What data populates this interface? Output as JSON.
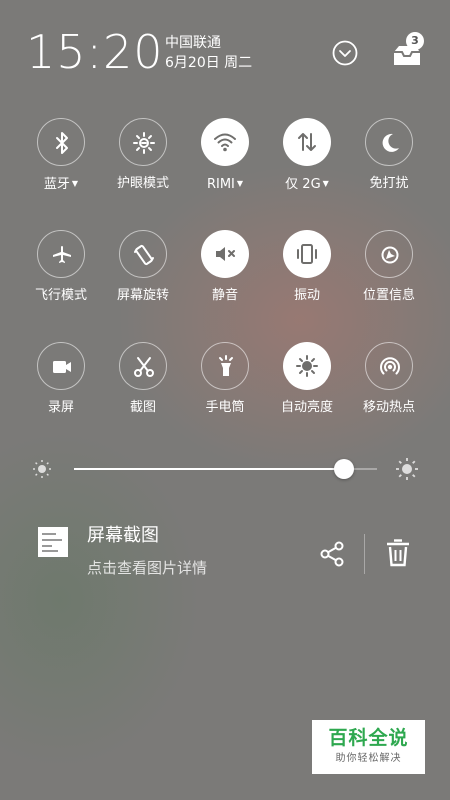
{
  "status": {
    "time": "15:20",
    "carrier": "中国联通",
    "date": "6月20日 周二",
    "notification_count": "3"
  },
  "toggles": [
    {
      "label": "蓝牙",
      "dropdown": true,
      "on": false,
      "icon": "bluetooth-icon"
    },
    {
      "label": "护眼模式",
      "dropdown": false,
      "on": false,
      "icon": "eye-care-icon"
    },
    {
      "label": "RIMI",
      "dropdown": true,
      "on": true,
      "icon": "wifi-icon"
    },
    {
      "label": "仅 2G",
      "dropdown": true,
      "on": true,
      "icon": "mobile-data-icon"
    },
    {
      "label": "免打扰",
      "dropdown": false,
      "on": false,
      "icon": "moon-icon"
    },
    {
      "label": "飞行模式",
      "dropdown": false,
      "on": false,
      "icon": "airplane-icon"
    },
    {
      "label": "屏幕旋转",
      "dropdown": false,
      "on": false,
      "icon": "rotate-icon"
    },
    {
      "label": "静音",
      "dropdown": false,
      "on": true,
      "icon": "mute-icon"
    },
    {
      "label": "振动",
      "dropdown": false,
      "on": true,
      "icon": "vibrate-icon"
    },
    {
      "label": "位置信息",
      "dropdown": false,
      "on": false,
      "icon": "location-icon"
    },
    {
      "label": "录屏",
      "dropdown": false,
      "on": false,
      "icon": "screen-record-icon"
    },
    {
      "label": "截图",
      "dropdown": false,
      "on": false,
      "icon": "scissors-icon"
    },
    {
      "label": "手电筒",
      "dropdown": false,
      "on": false,
      "icon": "flashlight-icon"
    },
    {
      "label": "自动亮度",
      "dropdown": false,
      "on": true,
      "icon": "auto-brightness-icon"
    },
    {
      "label": "移动热点",
      "dropdown": false,
      "on": false,
      "icon": "hotspot-icon"
    }
  ],
  "brightness": {
    "level": 0.89
  },
  "notification": {
    "title": "屏幕截图",
    "subtitle": "点击查看图片详情"
  },
  "watermark": {
    "title": "百科全说",
    "subtitle": "助你轻松解决"
  }
}
